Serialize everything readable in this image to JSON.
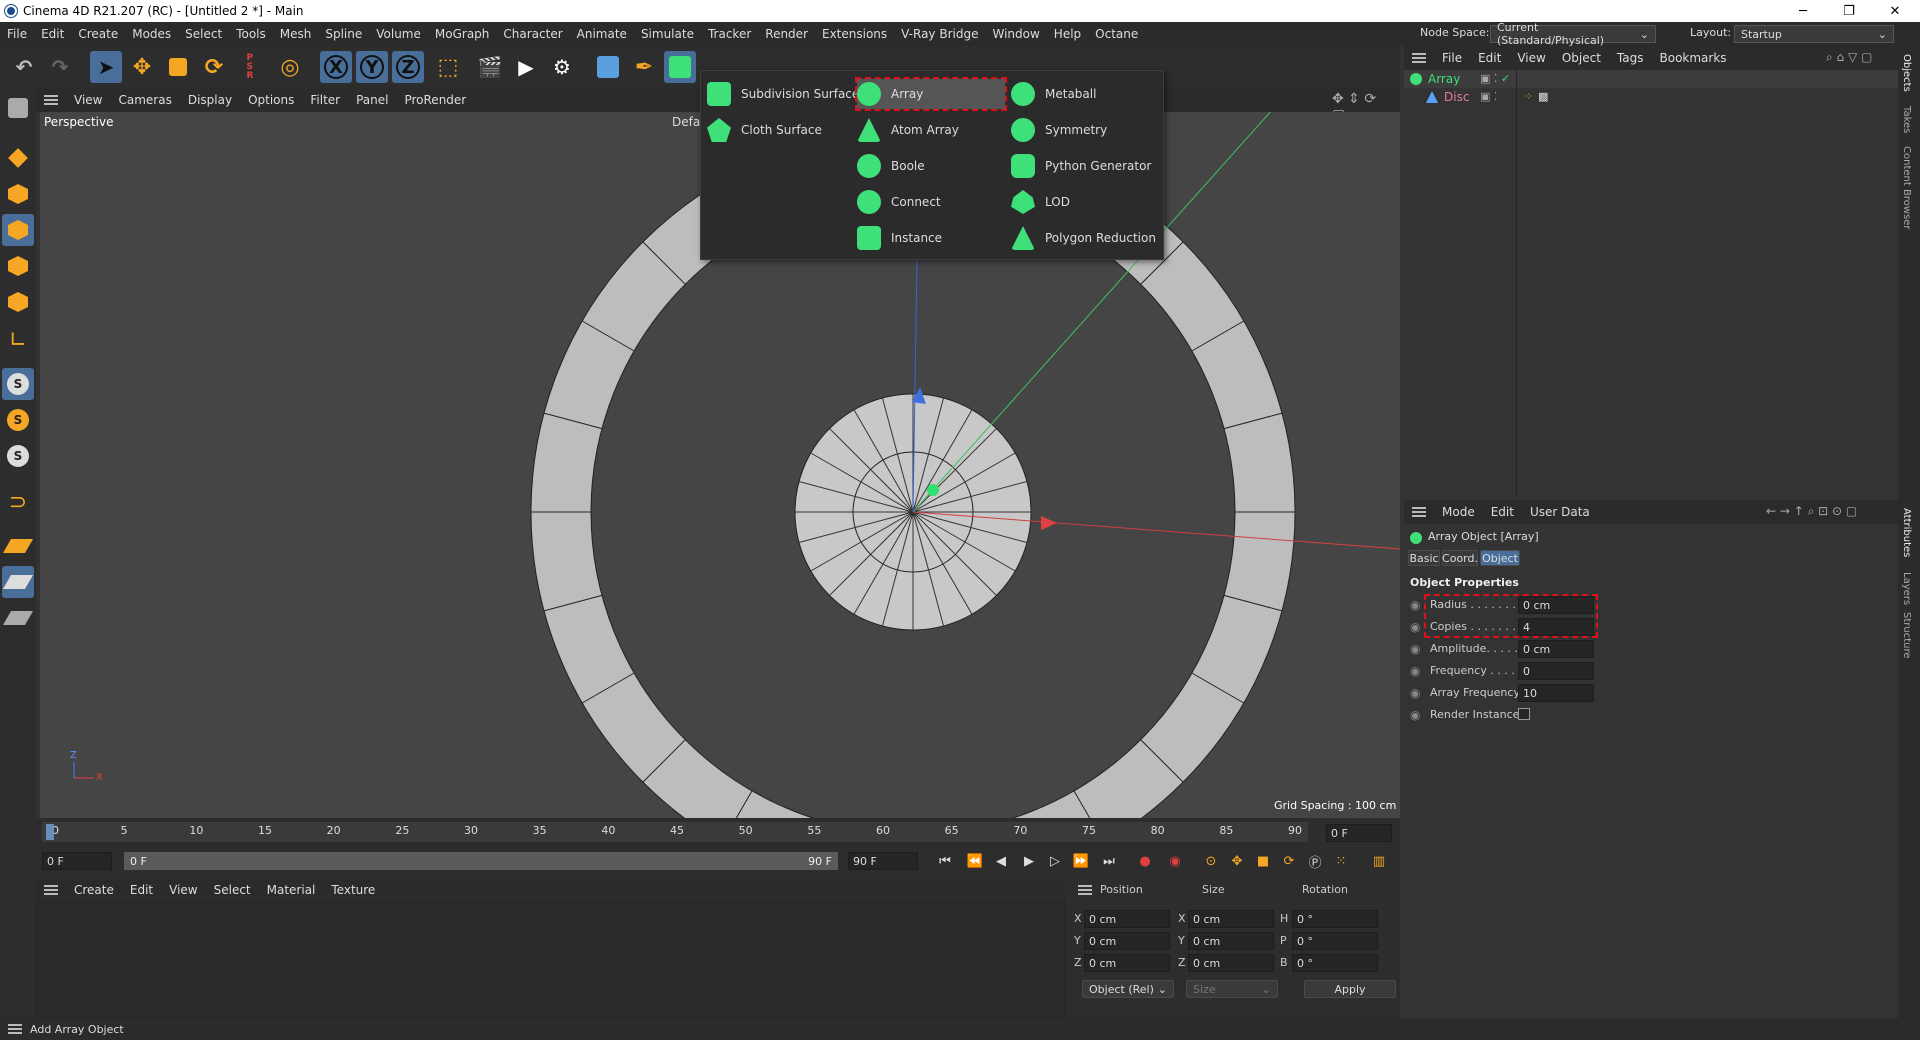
{
  "app": {
    "title": "Cinema 4D R21.207 (RC) - [Untitled 2 *] - Main"
  },
  "window_controls": {
    "minimize": "─",
    "restore": "❐",
    "close": "✕"
  },
  "menubar": {
    "items": [
      "File",
      "Edit",
      "Create",
      "Modes",
      "Select",
      "Tools",
      "Mesh",
      "Spline",
      "Volume",
      "MoGraph",
      "Character",
      "Animate",
      "Simulate",
      "Tracker",
      "Render",
      "Extensions",
      "V-Ray Bridge",
      "Window",
      "Help",
      "Octane"
    ],
    "node_space_label": "Node Space:",
    "node_space_value": "Current (Standard/Physical)",
    "layout_label": "Layout:",
    "layout_value": "Startup"
  },
  "viewport": {
    "menu": [
      "View",
      "Cameras",
      "Display",
      "Options",
      "Filter",
      "Panel",
      "ProRender"
    ],
    "name": "Perspective",
    "camera_label": "Defau",
    "grid_spacing": "Grid Spacing : 100 cm",
    "axis_z": "Z",
    "axis_x": "X"
  },
  "generator_menu": {
    "col1": [
      {
        "label": "Subdivision Surface",
        "icon": "subdivision-surface-icon"
      },
      {
        "label": "Cloth Surface",
        "icon": "cloth-surface-icon"
      }
    ],
    "col2": [
      {
        "label": "Array",
        "icon": "array-icon"
      },
      {
        "label": "Atom Array",
        "icon": "atom-array-icon"
      },
      {
        "label": "Boole",
        "icon": "boole-icon"
      },
      {
        "label": "Connect",
        "icon": "connect-icon"
      },
      {
        "label": "Instance",
        "icon": "instance-icon"
      }
    ],
    "col3": [
      {
        "label": "Metaball",
        "icon": "metaball-icon"
      },
      {
        "label": "Symmetry",
        "icon": "symmetry-icon"
      },
      {
        "label": "Python Generator",
        "icon": "python-generator-icon"
      },
      {
        "label": "LOD",
        "icon": "lod-icon"
      },
      {
        "label": "Polygon Reduction",
        "icon": "polygon-reduction-icon"
      }
    ]
  },
  "toolbar": {
    "axis_x": "X",
    "axis_y": "Y",
    "axis_z": "Z"
  },
  "timeline": {
    "ticks": [
      "0",
      "5",
      "10",
      "15",
      "20",
      "25",
      "30",
      "35",
      "40",
      "45",
      "50",
      "55",
      "60",
      "65",
      "70",
      "75",
      "80",
      "85",
      "90"
    ],
    "current_frame_field": "0 F",
    "start_field": "0 F",
    "range_start": "0 F",
    "range_end": "90 F",
    "end_field": "90 F"
  },
  "material_manager": {
    "menu": [
      "Create",
      "Edit",
      "View",
      "Select",
      "Material",
      "Texture"
    ]
  },
  "coordinates": {
    "headers": [
      "Position",
      "Size",
      "Rotation"
    ],
    "rows": [
      {
        "axis": "X",
        "pos": "0 cm",
        "size_axis": "X",
        "size": "0 cm",
        "rot_axis": "H",
        "rot": "0 °"
      },
      {
        "axis": "Y",
        "pos": "0 cm",
        "size_axis": "Y",
        "size": "0 cm",
        "rot_axis": "P",
        "rot": "0 °"
      },
      {
        "axis": "Z",
        "pos": "0 cm",
        "size_axis": "Z",
        "size": "0 cm",
        "rot_axis": "B",
        "rot": "0 °"
      }
    ],
    "mode": "Object (Rel)",
    "size_mode": "Size",
    "apply": "Apply"
  },
  "object_manager": {
    "menu": [
      "File",
      "Edit",
      "View",
      "Object",
      "Tags",
      "Bookmarks"
    ],
    "objects": [
      {
        "name": "Array",
        "color": "#3ee07a"
      },
      {
        "name": "Disc",
        "color": "#5aa0ff"
      }
    ]
  },
  "attributes": {
    "menu": [
      "Mode",
      "Edit",
      "User Data"
    ],
    "object_title": "Array Object [Array]",
    "tabs": [
      "Basic",
      "Coord.",
      "Object"
    ],
    "active_tab": "Object",
    "section": "Object Properties",
    "props": [
      {
        "label": "Radius . . . . . . .",
        "value": "0 cm"
      },
      {
        "label": "Copies . . . . . . .",
        "value": "4"
      },
      {
        "label": "Amplitude. . . . . .",
        "value": "0 cm"
      },
      {
        "label": "Frequency . . . . .",
        "value": "0"
      },
      {
        "label": "Array Frequency",
        "value": "10"
      }
    ],
    "render_instance": "Render Instance"
  },
  "side_tabs": {
    "top": [
      "Objects",
      "Takes",
      "Content Browser"
    ],
    "bottom": [
      "Attributes",
      "Layers",
      "Structure"
    ]
  },
  "status": {
    "text": "Add Array Object"
  },
  "colors": {
    "accent": "#4a6e9a",
    "highlight_dash": "#e0101a",
    "generator_green": "#3ee07a"
  }
}
